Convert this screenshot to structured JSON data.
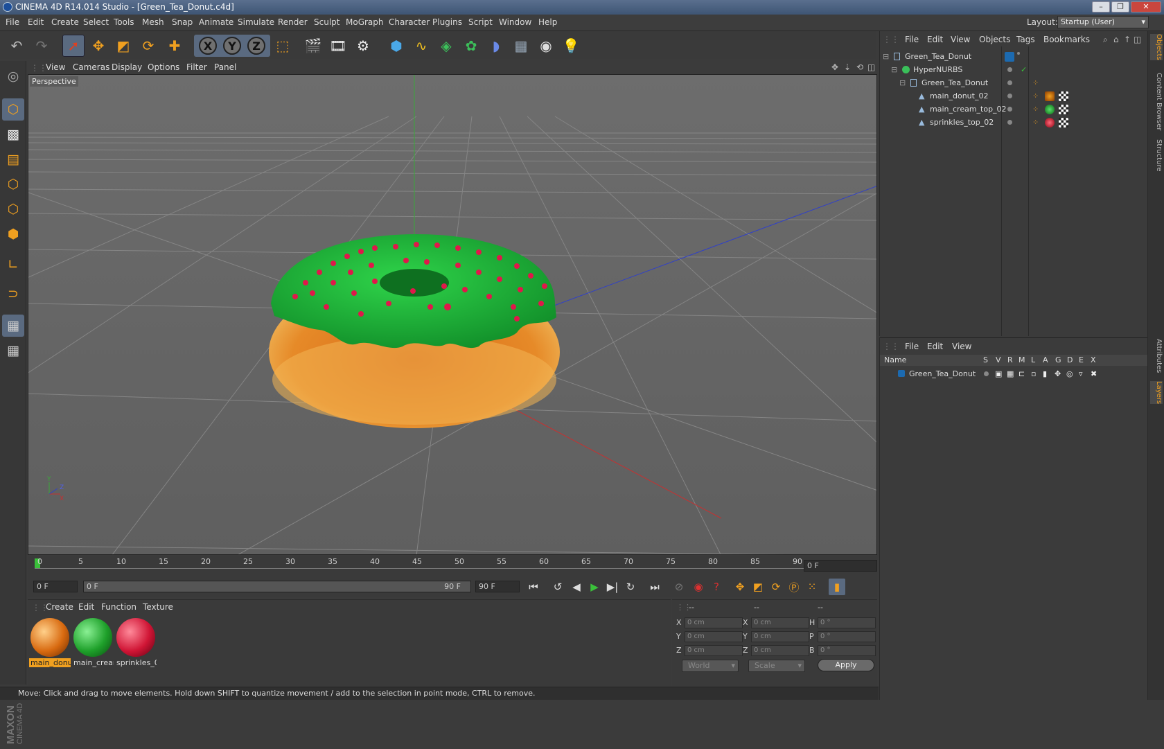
{
  "window": {
    "title": "CINEMA 4D R14.014 Studio - [Green_Tea_Donut.c4d]",
    "controls": [
      "–",
      "❐",
      "✕"
    ]
  },
  "menubar": {
    "items": [
      "File",
      "Edit",
      "Create",
      "Select",
      "Tools",
      "Mesh",
      "Snap",
      "Animate",
      "Simulate",
      "Render",
      "Sculpt",
      "MoGraph",
      "Character",
      "Plugins",
      "Script",
      "Window",
      "Help"
    ],
    "layout_label": "Layout:",
    "layout_value": "Startup (User)"
  },
  "toolbar": {
    "axis_x": "X",
    "axis_y": "Y",
    "axis_z": "Z"
  },
  "viewport": {
    "menu": [
      "View",
      "Cameras",
      "Display",
      "Options",
      "Filter",
      "Panel"
    ],
    "label": "Perspective",
    "axis_labels": {
      "y": "Y",
      "x": "X",
      "z": "Z"
    }
  },
  "timeline": {
    "ticks": [
      "0",
      "5",
      "10",
      "15",
      "20",
      "25",
      "30",
      "35",
      "40",
      "45",
      "50",
      "55",
      "60",
      "65",
      "70",
      "75",
      "80",
      "85",
      "90"
    ],
    "current_frame": "0 F"
  },
  "transport": {
    "start_field": "0 F",
    "range_start": "0 F",
    "range_end": "90 F",
    "end_field": "90 F"
  },
  "material_panel": {
    "menu": [
      "Create",
      "Edit",
      "Function",
      "Texture"
    ],
    "materials": [
      {
        "name": "main_donu",
        "color": "#d86a10",
        "selected": true
      },
      {
        "name": "main_crean",
        "color": "#1ea02a",
        "selected": false
      },
      {
        "name": "sprinkles_0",
        "color": "#d01535",
        "selected": false
      }
    ]
  },
  "coords": {
    "header": [
      "--",
      "--",
      "--"
    ],
    "rows": [
      {
        "a_label": "X",
        "a_val": "0 cm",
        "b_label": "X",
        "b_val": "0 cm",
        "c_label": "H",
        "c_val": "0 °"
      },
      {
        "a_label": "Y",
        "a_val": "0 cm",
        "b_label": "Y",
        "b_val": "0 cm",
        "c_label": "P",
        "c_val": "0 °"
      },
      {
        "a_label": "Z",
        "a_val": "0 cm",
        "b_label": "Z",
        "b_val": "0 cm",
        "c_label": "B",
        "c_val": "0 °"
      }
    ],
    "space": "World",
    "mode": "Scale",
    "apply": "Apply"
  },
  "status": "Move: Click and drag to move elements. Hold down SHIFT to quantize movement / add to the selection in point mode, CTRL to remove.",
  "object_manager": {
    "menu": [
      "File",
      "Edit",
      "View",
      "Objects",
      "Tags",
      "Bookmarks"
    ],
    "objects": [
      {
        "name": "Green_Tea_Donut",
        "indent": 0,
        "icon": "null-object-icon"
      },
      {
        "name": "HyperNURBS",
        "indent": 1,
        "icon": "hypernurbs-icon"
      },
      {
        "name": "Green_Tea_Donut",
        "indent": 2,
        "icon": "null-object-icon"
      },
      {
        "name": "main_donut_02",
        "indent": 3,
        "icon": "polygon-object-icon",
        "material": "#d86a10"
      },
      {
        "name": "main_cream_top_02",
        "indent": 3,
        "icon": "polygon-object-icon",
        "material": "#1ea02a"
      },
      {
        "name": "sprinkles_top_02",
        "indent": 3,
        "icon": "polygon-object-icon",
        "material": "#d01535"
      }
    ]
  },
  "layer_manager": {
    "menu": [
      "File",
      "Edit",
      "View"
    ],
    "columns": [
      "Name",
      "S",
      "V",
      "R",
      "M",
      "L",
      "A",
      "G",
      "D",
      "E",
      "X"
    ],
    "layers": [
      {
        "name": "Green_Tea_Donut"
      }
    ]
  },
  "side_tabs": [
    "Objects",
    "Content Browser",
    "Structure",
    "Attributes",
    "Layers"
  ],
  "brand": {
    "line1": "MAXON",
    "line2": "CINEMA 4D"
  },
  "colors": {
    "accent": "#f0a020",
    "select_blue": "#5a6a80",
    "material_highlight": "#f0a020"
  }
}
